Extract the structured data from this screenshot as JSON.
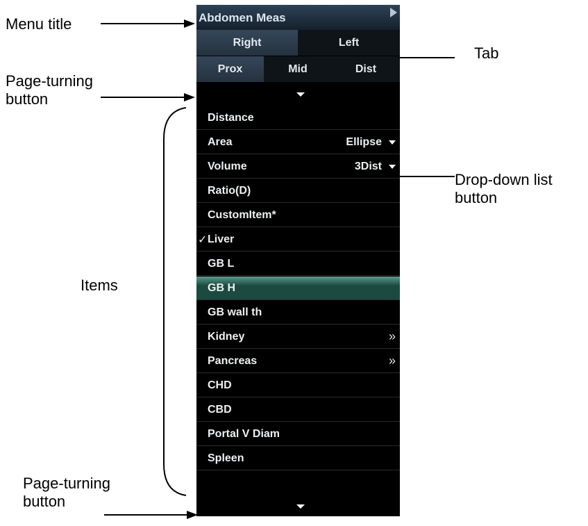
{
  "callouts": {
    "menu_title": "Menu title",
    "tab": "Tab",
    "page_turning_top": "Page-turning\nbutton",
    "dropdown": "Drop-down list\nbutton",
    "items": "Items",
    "page_turning_bottom": "Page-turning\nbutton"
  },
  "panel": {
    "title": "Abdomen Meas",
    "tabs_row1": [
      "Right",
      "Left"
    ],
    "tabs_row2": [
      "Prox",
      "Mid",
      "Dist"
    ],
    "items": [
      {
        "label": "Distance",
        "value": "",
        "dropdown": false,
        "submenu": false,
        "checked": false,
        "highlight": false
      },
      {
        "label": "Area",
        "value": "Ellipse",
        "dropdown": true,
        "submenu": false,
        "checked": false,
        "highlight": false
      },
      {
        "label": "Volume",
        "value": "3Dist",
        "dropdown": true,
        "submenu": false,
        "checked": false,
        "highlight": false
      },
      {
        "label": "Ratio(D)",
        "value": "",
        "dropdown": false,
        "submenu": false,
        "checked": false,
        "highlight": false
      },
      {
        "label": "CustomItem*",
        "value": "",
        "dropdown": false,
        "submenu": false,
        "checked": false,
        "highlight": false
      },
      {
        "label": "Liver",
        "value": "",
        "dropdown": false,
        "submenu": false,
        "checked": true,
        "highlight": false
      },
      {
        "label": "GB L",
        "value": "",
        "dropdown": false,
        "submenu": false,
        "checked": false,
        "highlight": false
      },
      {
        "label": "GB H",
        "value": "",
        "dropdown": false,
        "submenu": false,
        "checked": false,
        "highlight": true
      },
      {
        "label": "GB wall th",
        "value": "",
        "dropdown": false,
        "submenu": false,
        "checked": false,
        "highlight": false
      },
      {
        "label": "Kidney",
        "value": "",
        "dropdown": false,
        "submenu": true,
        "checked": false,
        "highlight": false
      },
      {
        "label": "Pancreas",
        "value": "",
        "dropdown": false,
        "submenu": true,
        "checked": false,
        "highlight": false
      },
      {
        "label": "CHD",
        "value": "",
        "dropdown": false,
        "submenu": false,
        "checked": false,
        "highlight": false
      },
      {
        "label": "CBD",
        "value": "",
        "dropdown": false,
        "submenu": false,
        "checked": false,
        "highlight": false
      },
      {
        "label": "Portal V Diam",
        "value": "",
        "dropdown": false,
        "submenu": false,
        "checked": false,
        "highlight": false
      },
      {
        "label": "Spleen",
        "value": "",
        "dropdown": false,
        "submenu": false,
        "checked": false,
        "highlight": false
      }
    ],
    "check_glyph": "✓",
    "submenu_glyph": "»"
  }
}
